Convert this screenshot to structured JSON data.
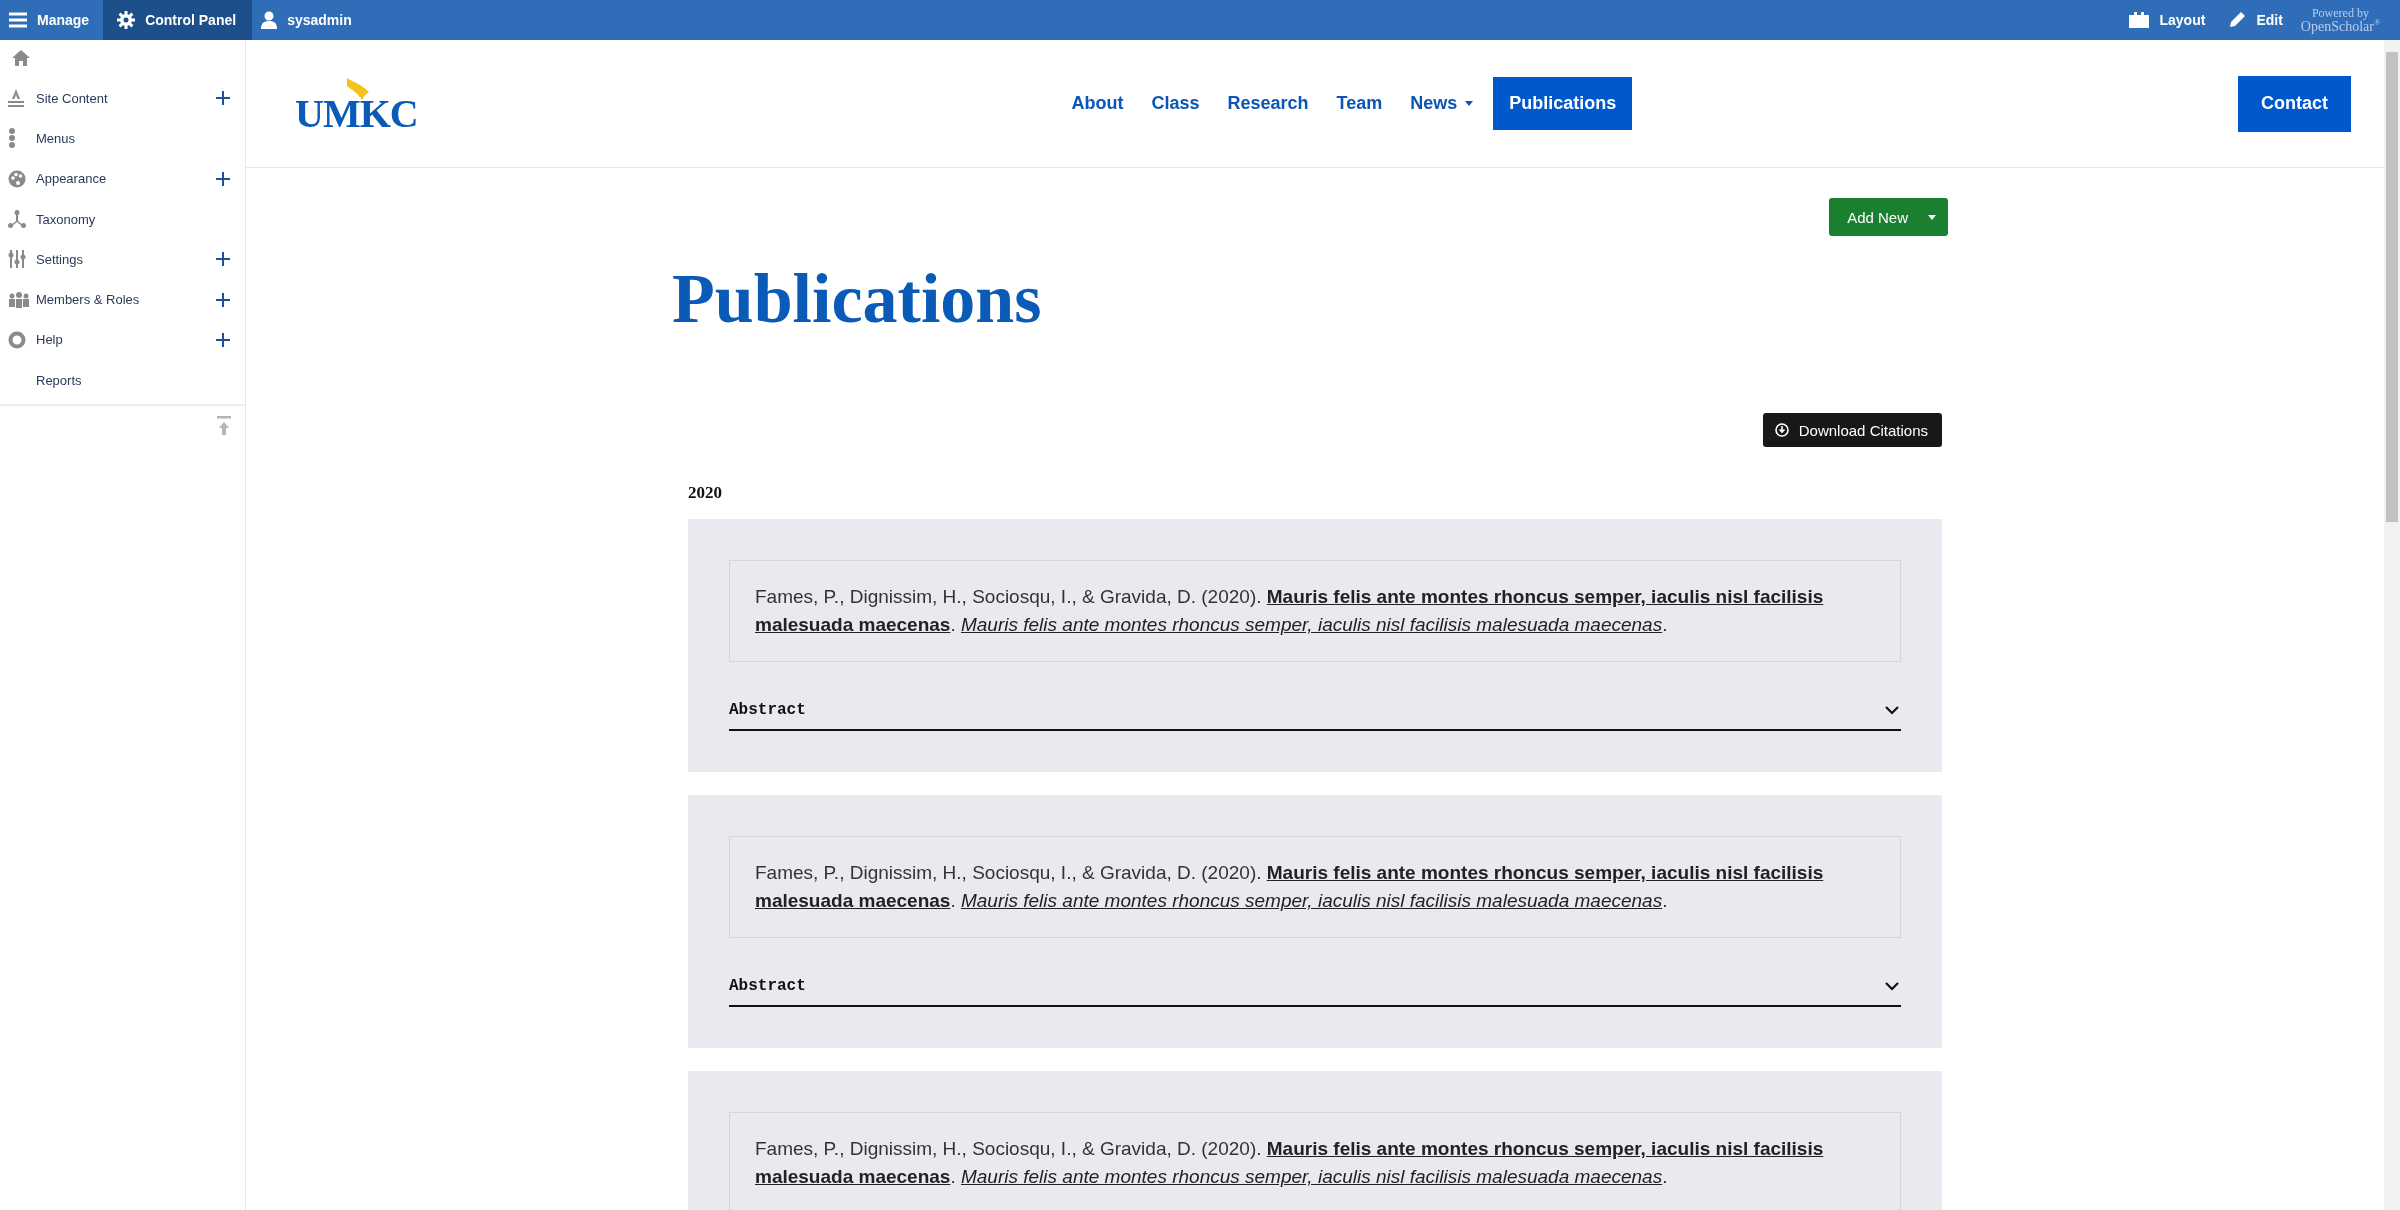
{
  "admin_bar": {
    "left_items": [
      {
        "label": "Manage",
        "selected": false
      },
      {
        "label": "Control Panel",
        "selected": true
      },
      {
        "label": "sysadmin",
        "selected": false
      }
    ],
    "right_items": [
      {
        "label": "Layout"
      },
      {
        "label": "Edit"
      }
    ],
    "powered_by": "Powered by",
    "brand": "OpenScholar$^{®}$"
  },
  "sidebar": {
    "items": [
      {
        "label": "Site Content",
        "expandable": true
      },
      {
        "label": "Menus",
        "expandable": false
      },
      {
        "label": "Appearance",
        "expandable": true
      },
      {
        "label": "Taxonomy",
        "expandable": false
      },
      {
        "label": "Settings",
        "expandable": true
      },
      {
        "label": "Members & Roles",
        "expandable": true
      },
      {
        "label": "Help",
        "expandable": true
      },
      {
        "label": "Reports",
        "expandable": false
      }
    ]
  },
  "header": {
    "logo": "UMKC",
    "nav": [
      {
        "label": "About",
        "selected": false,
        "dropdown": false
      },
      {
        "label": "Class",
        "selected": false,
        "dropdown": false
      },
      {
        "label": "Research",
        "selected": false,
        "dropdown": false
      },
      {
        "label": "Team",
        "selected": false,
        "dropdown": false
      },
      {
        "label": "News",
        "selected": false,
        "dropdown": true
      },
      {
        "label": "Publications",
        "selected": true,
        "dropdown": false
      }
    ],
    "contact": "Contact"
  },
  "page": {
    "title": "Publications",
    "add_button": "Add New",
    "download_button": "Download Citations",
    "year": "2020",
    "publications": [
      {
        "citation": "Fames, P., Dignissim, H., Sociosqu, I., & Gravida, D. (2020). **Mauris felis ante montes rhoncus semper, iaculis nisl facilisis malesuada maecenas**. *Mauris felis ante montes rhoncus semper, iaculis nisl facilisis malesuada maecenas*.",
        "abstract": "Abstract",
        "expanded": false
      },
      {
        "citation": "Fames, P., Dignissim, H., Sociosqu, I., & Gravida, D. (2020). **Mauris felis ante montes rhoncus semper, iaculis nisl facilisis malesuada maecenas**. *Mauris felis ante montes rhoncus semper, iaculis nisl facilisis malesuada maecenas*.",
        "abstract": "Abstract",
        "expanded": false
      },
      {
        "citation": "Fames, P., Dignissim, H., Sociosqu, I., & Gravida, D. (2020). **Mauris felis ante montes rhoncus semper, iaculis nisl facilisis malesuada maecenas**. *Mauris felis ante montes rhoncus semper, iaculis nisl facilisis malesuada maecenas*."
      }
    ]
  }
}
